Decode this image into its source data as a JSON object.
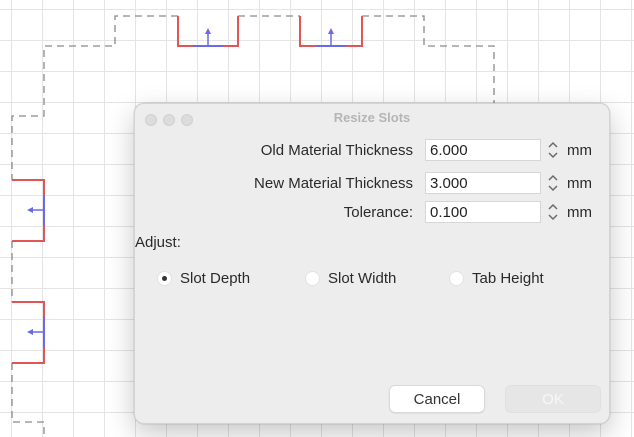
{
  "dialog": {
    "title": "Resize Slots",
    "fields": [
      {
        "label": "Old Material Thickness",
        "value": "6.000",
        "unit": "mm"
      },
      {
        "label": "New Material Thickness",
        "value": "3.000",
        "unit": "mm"
      },
      {
        "label": "Tolerance:",
        "value": "0.100",
        "unit": "mm"
      }
    ],
    "adjust_label": "Adjust:",
    "radio_options": [
      {
        "label": "Slot Depth",
        "selected": true
      },
      {
        "label": "Slot Width",
        "selected": false
      },
      {
        "label": "Tab Height",
        "selected": false
      }
    ],
    "cancel_label": "Cancel",
    "ok_label": "OK"
  },
  "colors": {
    "outline_dashed": "#8a8a8a",
    "slot_red": "#e05555",
    "slot_blue": "#6a6ae6"
  }
}
